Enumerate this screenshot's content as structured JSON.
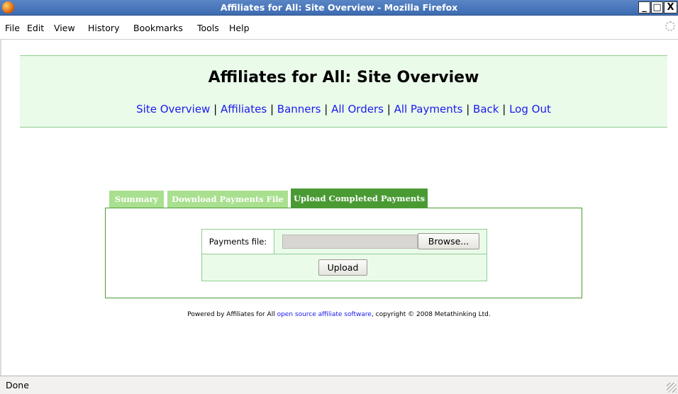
{
  "window": {
    "title": "Affiliates for All: Site Overview - Mozilla Firefox",
    "min_label": "_",
    "max_label": "□",
    "close_label": "X"
  },
  "menu": {
    "items": [
      "File",
      "Edit",
      "View",
      "History",
      "Bookmarks",
      "Tools",
      "Help"
    ]
  },
  "header": {
    "title": "Affiliates for All: Site Overview",
    "nav": [
      {
        "label": "Site Overview"
      },
      {
        "label": "Affiliates"
      },
      {
        "label": "Banners"
      },
      {
        "label": "All Orders"
      },
      {
        "label": "All Payments"
      },
      {
        "label": "Back"
      },
      {
        "label": "Log Out"
      }
    ],
    "separator": "|"
  },
  "tabs": [
    {
      "label": "Summary",
      "active": false
    },
    {
      "label": "Download Payments File",
      "active": false
    },
    {
      "label": "Upload Completed Payments",
      "active": true
    }
  ],
  "form": {
    "file_label": "Payments file:",
    "file_value": "",
    "browse_label": "Browse...",
    "upload_label": "Upload"
  },
  "footer": {
    "prefix": "Powered by Affiliates for All ",
    "link": "open source affiliate software",
    "suffix": ", copyright © 2008 Metathinking Ltd."
  },
  "status": {
    "text": "Done"
  },
  "colors": {
    "header_bg": "#eafbea",
    "tab_active": "#4a9a34",
    "tab_inactive": "#a9e08f",
    "link": "#1a1aee"
  }
}
